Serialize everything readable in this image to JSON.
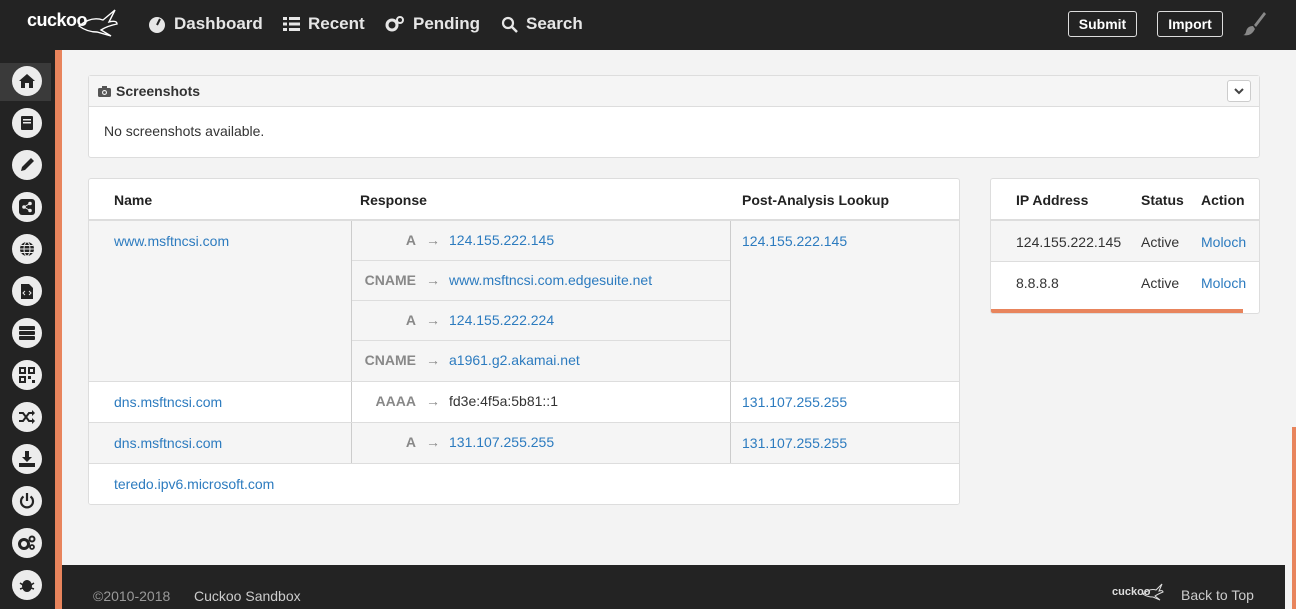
{
  "topnav": {
    "logo": "cuckoo",
    "items": [
      {
        "label": "Dashboard",
        "icon": "dashboard-icon"
      },
      {
        "label": "Recent",
        "icon": "list-icon"
      },
      {
        "label": "Pending",
        "icon": "cogs-icon"
      },
      {
        "label": "Search",
        "icon": "search-icon"
      }
    ],
    "submit_label": "Submit",
    "import_label": "Import"
  },
  "sidebar": {
    "icons": [
      "home-icon",
      "book-icon",
      "pencil-icon",
      "share-icon",
      "globe-icon",
      "file-code-icon",
      "server-icon",
      "qrcode-icon",
      "shuffle-icon",
      "download-icon",
      "power-icon",
      "cogs-icon",
      "bug-icon"
    ]
  },
  "screenshots": {
    "title": "Screenshots",
    "message": "No screenshots available."
  },
  "dns": {
    "headers": {
      "name": "Name",
      "response": "Response",
      "post": "Post-Analysis Lookup"
    },
    "rows": [
      {
        "name": "www.msftncsi.com",
        "responses": [
          {
            "type": "A",
            "value": "124.155.222.145"
          },
          {
            "type": "CNAME",
            "value": "www.msftncsi.com.edgesuite.net"
          },
          {
            "type": "A",
            "value": "124.155.222.224"
          },
          {
            "type": "CNAME",
            "value": "a1961.g2.akamai.net"
          }
        ],
        "post": "124.155.222.145"
      },
      {
        "name": "dns.msftncsi.com",
        "responses": [
          {
            "type": "AAAA",
            "value": "fd3e:4f5a:5b81::1"
          }
        ],
        "post": "131.107.255.255"
      },
      {
        "name": "dns.msftncsi.com",
        "responses": [
          {
            "type": "A",
            "value": "131.107.255.255"
          }
        ],
        "post": "131.107.255.255"
      },
      {
        "name": "teredo.ipv6.microsoft.com",
        "responses": [],
        "post": ""
      }
    ],
    "arrow": "→"
  },
  "hosts": {
    "headers": {
      "ip": "IP Address",
      "status": "Status",
      "action": "Action"
    },
    "rows": [
      {
        "ip": "124.155.222.145",
        "status": "Active",
        "action": "Moloch"
      },
      {
        "ip": "8.8.8.8",
        "status": "Active",
        "action": "Moloch"
      }
    ]
  },
  "footer": {
    "copyright": "©2010-2018",
    "brand": "Cuckoo Sandbox",
    "logo": "cuckoo",
    "back_to_top": "Back to Top"
  },
  "colors": {
    "accent": "#e8845c",
    "nav_bg": "#232323",
    "link": "#2c7bbf"
  }
}
